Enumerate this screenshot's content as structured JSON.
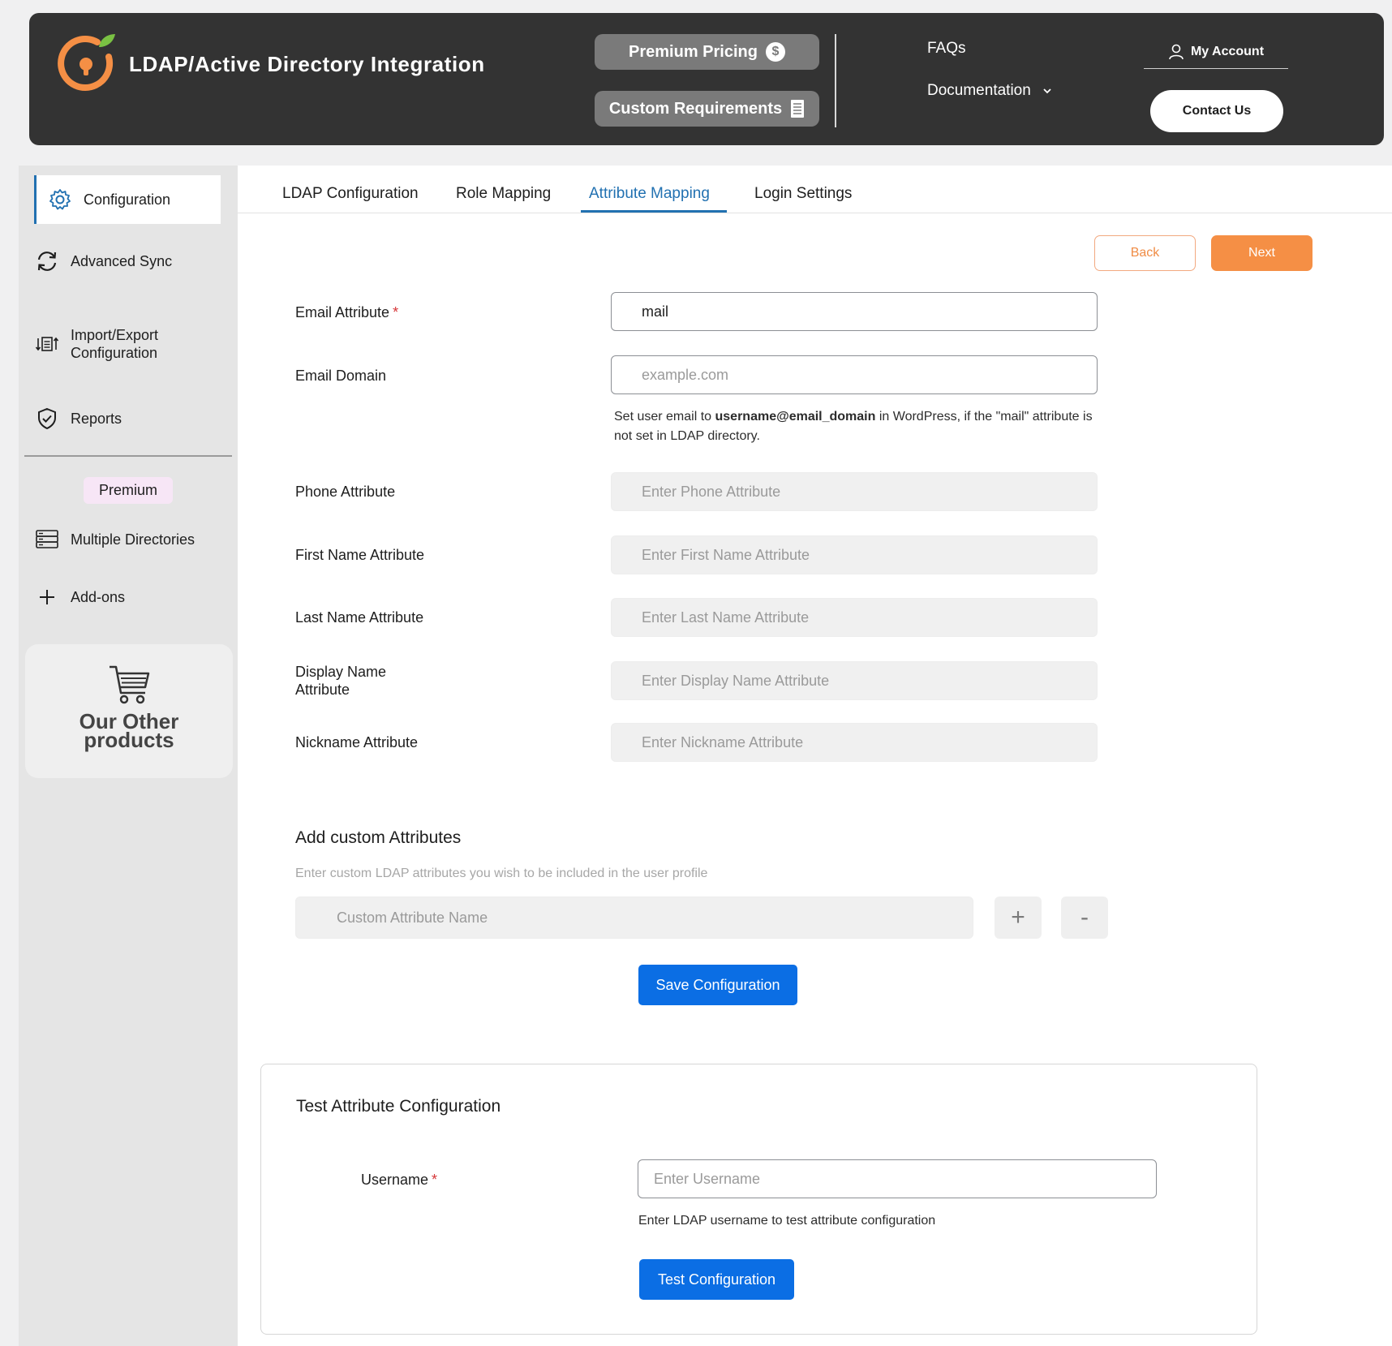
{
  "header": {
    "title": "LDAP/Active Directory Integration",
    "premium_pricing": "Premium Pricing",
    "dollar_glyph": "$",
    "custom_requirements": "Custom Requirements",
    "faqs": "FAQs",
    "documentation": "Documentation",
    "my_account": "My Account",
    "contact_us": "Contact Us",
    "brand_color": "#f58f45"
  },
  "sidebar": {
    "items": [
      {
        "label": "Configuration",
        "icon": "gear-icon"
      },
      {
        "label": "Advanced Sync",
        "icon": "sync-icon"
      },
      {
        "label": "Import/Export\nConfiguration",
        "icon": "import-export-icon"
      },
      {
        "label": "Reports",
        "icon": "shield-check-icon"
      }
    ],
    "premium_badge": "Premium",
    "premium_items": [
      {
        "label": "Multiple Directories",
        "icon": "server-stack-icon"
      },
      {
        "label": "Add-ons",
        "icon": "plus-icon"
      }
    ],
    "other_products": "Our Other\nproducts"
  },
  "tabs": [
    {
      "label": "LDAP Configuration"
    },
    {
      "label": "Role Mapping"
    },
    {
      "label": "Attribute Mapping",
      "active": true
    },
    {
      "label": "Login Settings"
    }
  ],
  "nav_buttons": {
    "back": "Back",
    "next": "Next"
  },
  "fields": {
    "email_attr": {
      "label": "Email Attribute",
      "required_mark": "*",
      "value": "mail"
    },
    "email_domain": {
      "label": "Email Domain",
      "placeholder": "example.com"
    },
    "email_help": {
      "prefix": "Set user email to ",
      "bold": "username@email_domain",
      "suffix": " in WordPress, if the \"mail\" attribute is not set in LDAP directory."
    },
    "phone": {
      "label": "Phone Attribute",
      "placeholder": "Enter Phone Attribute"
    },
    "first_name": {
      "label": "First Name Attribute",
      "placeholder": "Enter First Name Attribute"
    },
    "last_name": {
      "label": "Last Name Attribute",
      "placeholder": "Enter Last Name Attribute"
    },
    "display_name": {
      "label": "Display Name\nAttribute",
      "placeholder": "Enter Display Name Attribute"
    },
    "nickname": {
      "label": "Nickname Attribute",
      "placeholder": "Enter Nickname Attribute"
    }
  },
  "custom_attributes": {
    "title": "Add custom Attributes",
    "description": "Enter custom LDAP attributes you wish to be included in the user profile",
    "placeholder": "Custom Attribute Name",
    "add": "+",
    "remove": "-"
  },
  "save_button": "Save Configuration",
  "test": {
    "title": "Test Attribute Configuration",
    "username_label": "Username",
    "required_mark": "*",
    "username_placeholder": "Enter Username",
    "help": "Enter LDAP username to test attribute configuration",
    "button": "Test Configuration"
  }
}
